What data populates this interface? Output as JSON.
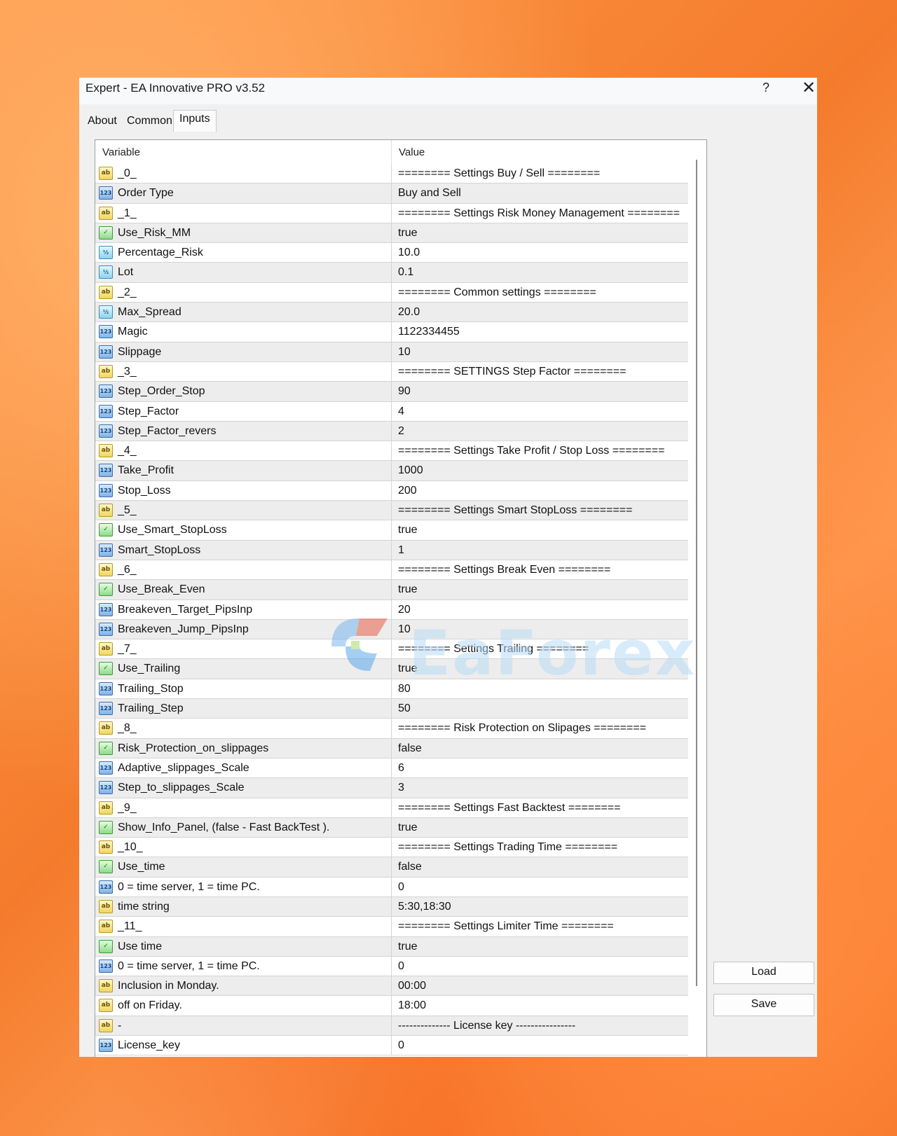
{
  "window": {
    "title": "Expert - EA Innovative PRO v3.52",
    "help_label": "?",
    "close_label": "✕"
  },
  "tabs": [
    {
      "label": "About"
    },
    {
      "label": "Common"
    },
    {
      "label": "Inputs",
      "active": true
    }
  ],
  "columns": {
    "variable": "Variable",
    "value": "Value"
  },
  "rows": [
    {
      "type": "string",
      "icon": "ab",
      "variable": "_0_",
      "value": "======== Settings Buy / Sell ========"
    },
    {
      "type": "int",
      "icon": "123",
      "variable": "Order Type",
      "value": "Buy and Sell"
    },
    {
      "type": "string",
      "icon": "ab",
      "variable": "_1_",
      "value": "======== Settings Risk Money Management ========"
    },
    {
      "type": "bool",
      "icon": "✓",
      "variable": "Use_Risk_MM",
      "value": "true"
    },
    {
      "type": "double",
      "icon": "½",
      "variable": "Percentage_Risk",
      "value": "10.0"
    },
    {
      "type": "double",
      "icon": "½",
      "variable": "Lot",
      "value": "0.1"
    },
    {
      "type": "string",
      "icon": "ab",
      "variable": "_2_",
      "value": "======== Common settings ========"
    },
    {
      "type": "double",
      "icon": "½",
      "variable": "Max_Spread",
      "value": "20.0"
    },
    {
      "type": "int",
      "icon": "123",
      "variable": "Magic",
      "value": "1122334455"
    },
    {
      "type": "int",
      "icon": "123",
      "variable": "Slippage",
      "value": "10"
    },
    {
      "type": "string",
      "icon": "ab",
      "variable": "_3_",
      "value": "======== SETTINGS Step Factor ========"
    },
    {
      "type": "int",
      "icon": "123",
      "variable": "Step_Order_Stop",
      "value": "90"
    },
    {
      "type": "int",
      "icon": "123",
      "variable": "Step_Factor",
      "value": "4"
    },
    {
      "type": "int",
      "icon": "123",
      "variable": "Step_Factor_revers",
      "value": "2"
    },
    {
      "type": "string",
      "icon": "ab",
      "variable": "_4_",
      "value": "======== Settings Take Profit / Stop Loss ========"
    },
    {
      "type": "int",
      "icon": "123",
      "variable": "Take_Profit",
      "value": "1000"
    },
    {
      "type": "int",
      "icon": "123",
      "variable": "Stop_Loss",
      "value": "200"
    },
    {
      "type": "string",
      "icon": "ab",
      "variable": "_5_",
      "value": "======== Settings Smart StopLoss ========"
    },
    {
      "type": "bool",
      "icon": "✓",
      "variable": "Use_Smart_StopLoss",
      "value": "true"
    },
    {
      "type": "int",
      "icon": "123",
      "variable": "Smart_StopLoss",
      "value": "1"
    },
    {
      "type": "string",
      "icon": "ab",
      "variable": "_6_",
      "value": "======== Settings Break Even  ========"
    },
    {
      "type": "bool",
      "icon": "✓",
      "variable": "Use_Break_Even",
      "value": "true"
    },
    {
      "type": "int",
      "icon": "123",
      "variable": "Breakeven_Target_PipsInp",
      "value": "20"
    },
    {
      "type": "int",
      "icon": "123",
      "variable": "Breakeven_Jump_PipsInp",
      "value": "10"
    },
    {
      "type": "string",
      "icon": "ab",
      "variable": "_7_",
      "value": "======== Settings Trailing  ========"
    },
    {
      "type": "bool",
      "icon": "✓",
      "variable": "Use_Trailing",
      "value": "true"
    },
    {
      "type": "int",
      "icon": "123",
      "variable": "Trailing_Stop",
      "value": "80"
    },
    {
      "type": "int",
      "icon": "123",
      "variable": "Trailing_Step",
      "value": "50"
    },
    {
      "type": "string",
      "icon": "ab",
      "variable": "_8_",
      "value": "======== Risk Protection on Slipages ========"
    },
    {
      "type": "bool",
      "icon": "✓",
      "variable": "Risk_Protection_on_slippages",
      "value": "false"
    },
    {
      "type": "int",
      "icon": "123",
      "variable": "Adaptive_slippages_Scale",
      "value": "6"
    },
    {
      "type": "int",
      "icon": "123",
      "variable": "Step_to_slippages_Scale",
      "value": "3"
    },
    {
      "type": "string",
      "icon": "ab",
      "variable": "_9_",
      "value": "======== Settings Fast Backtest ========"
    },
    {
      "type": "bool",
      "icon": "✓",
      "variable": "Show_Info_Panel, (false - Fast BackTest ).",
      "value": "true"
    },
    {
      "type": "string",
      "icon": "ab",
      "variable": "_10_",
      "value": "======== Settings Trading Time ========"
    },
    {
      "type": "bool",
      "icon": "✓",
      "variable": "Use_time",
      "value": "false"
    },
    {
      "type": "int",
      "icon": "123",
      "variable": "0 = time server, 1 = time PC.",
      "value": "0"
    },
    {
      "type": "string",
      "icon": "ab",
      "variable": "time string",
      "value": "5:30,18:30"
    },
    {
      "type": "string",
      "icon": "ab",
      "variable": "_11_",
      "value": "======== Settings Limiter Time ========"
    },
    {
      "type": "bool",
      "icon": "✓",
      "variable": "Use time",
      "value": "true"
    },
    {
      "type": "int",
      "icon": "123",
      "variable": "0 = time server, 1 = time PC.",
      "value": "0"
    },
    {
      "type": "string",
      "icon": "ab",
      "variable": "Inclusion in Monday.",
      "value": "00:00"
    },
    {
      "type": "string",
      "icon": "ab",
      "variable": "off on Friday.",
      "value": "18:00"
    },
    {
      "type": "string",
      "icon": "ab",
      "variable": "-",
      "value": "-------------- License key ----------------"
    },
    {
      "type": "int",
      "icon": "123",
      "variable": "License_key",
      "value": "0"
    }
  ],
  "buttons": {
    "load": "Load",
    "save": "Save"
  },
  "watermark": {
    "text": "EaForex"
  }
}
